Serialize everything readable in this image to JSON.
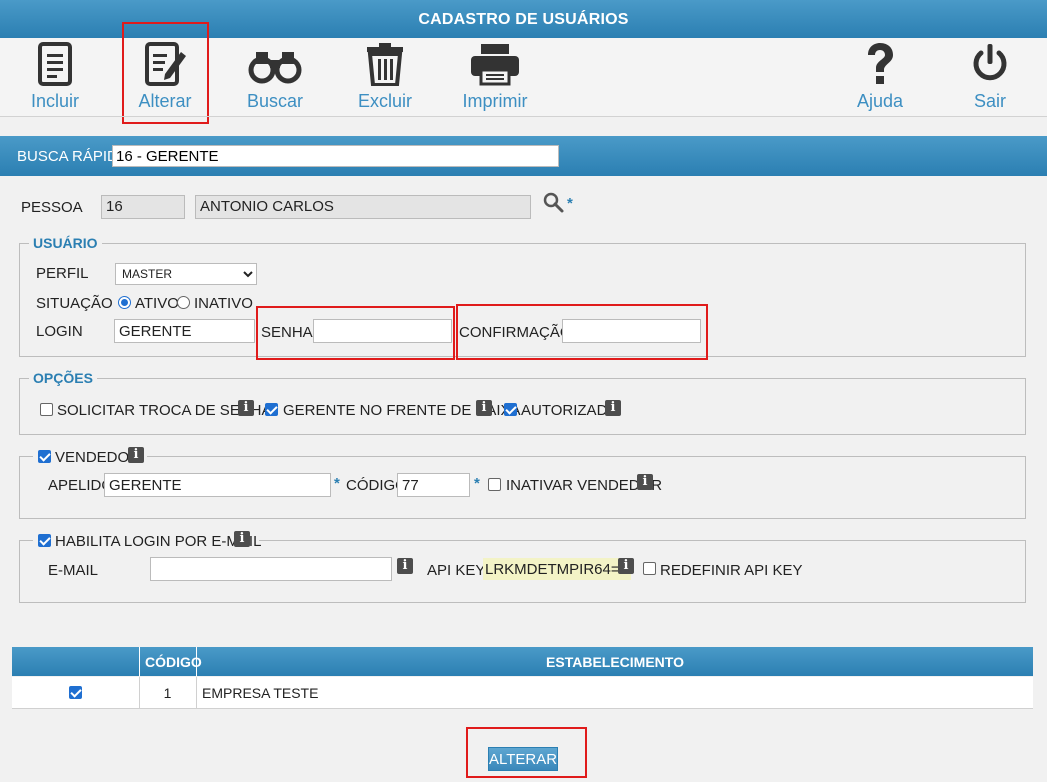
{
  "window": {
    "title": "CADASTRO DE USUÁRIOS"
  },
  "toolbar": {
    "incluir": "Incluir",
    "alterar": "Alterar",
    "buscar": "Buscar",
    "excluir": "Excluir",
    "imprimir": "Imprimir",
    "ajuda": "Ajuda",
    "sair": "Sair"
  },
  "search": {
    "label": "BUSCA RÁPIDA",
    "value": "16 - GERENTE"
  },
  "pessoa": {
    "label": "PESSOA",
    "code": "16",
    "name": "ANTONIO CARLOS",
    "required": "*"
  },
  "usuario": {
    "legend": "USUÁRIO",
    "perfil_label": "PERFIL",
    "perfil_value": "MASTER",
    "situacao_label": "SITUAÇÃO",
    "ativo_label": "ATIVO",
    "inativo_label": "INATIVO",
    "login_label": "LOGIN",
    "login_value": "GERENTE",
    "senha_label": "SENHA",
    "senha_value": "",
    "confirmacao_label": "CONFIRMAÇÃO",
    "confirmacao_value": ""
  },
  "opcoes": {
    "legend": "OPÇÕES",
    "troca_senha": "SOLICITAR TROCA DE SENHA",
    "gerente_caixa": "GERENTE NO FRENTE DE CAIXA",
    "autorizado": "AUTORIZADO"
  },
  "vendedor": {
    "legend": "VENDEDOR",
    "apelido_label": "APELIDO",
    "apelido_value": "GERENTE",
    "codigo_label": "CÓDIGO",
    "codigo_value": "77",
    "inativar_label": "INATIVAR VENDEDOR",
    "required": "*"
  },
  "email": {
    "legend": "HABILITA LOGIN POR E-MAIL",
    "email_label": "E-MAIL",
    "email_value": "",
    "apikey_label": "API KEY",
    "apikey_value": "LRKMDETMPIR64=Z",
    "redefinir_label": "REDEFINIR API KEY"
  },
  "grid": {
    "headers": [
      "",
      "CÓDIGO",
      "ESTABELECIMENTO"
    ],
    "rows": [
      {
        "checked": true,
        "codigo": "1",
        "estabelecimento": "EMPRESA TESTE"
      }
    ]
  },
  "footer": {
    "alterar_button": "ALTERAR"
  },
  "info_glyph": "i",
  "colors": {
    "accent": "#2b7fb2",
    "highlight_border": "#e01b1b",
    "checkbox": "#1f6fd1"
  },
  "icons": [
    "document-icon",
    "edit-document-icon",
    "binoculars-icon",
    "trash-icon",
    "printer-icon",
    "help-icon",
    "power-icon",
    "search-icon",
    "info-icon"
  ]
}
